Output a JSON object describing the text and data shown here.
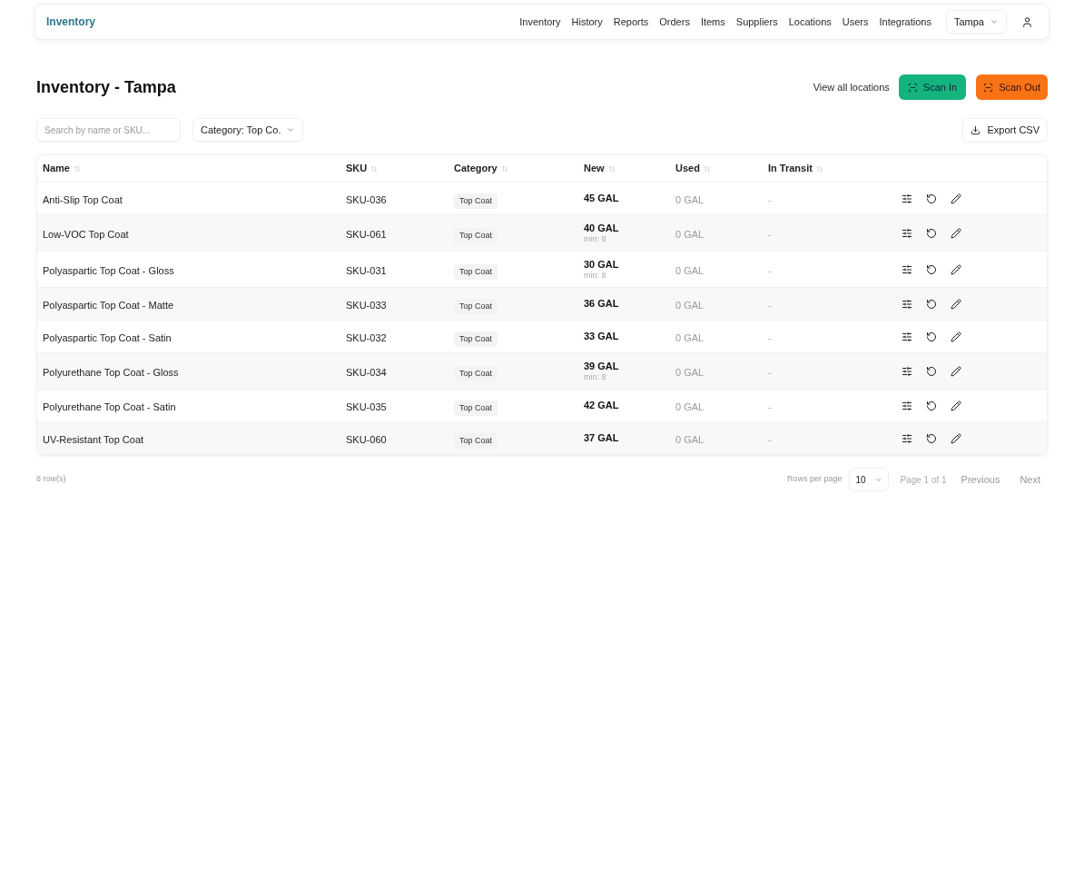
{
  "header": {
    "logo": "Inventory",
    "nav": [
      "Inventory",
      "History",
      "Reports",
      "Orders",
      "Items",
      "Suppliers",
      "Locations",
      "Users",
      "Integrations"
    ],
    "location_select": "Tampa"
  },
  "page": {
    "title": "Inventory - Tampa",
    "view_all_link": "View all locations",
    "scan_in": "Scan In",
    "scan_out": "Scan Out"
  },
  "toolbar": {
    "search": {
      "placeholder": "Search by name or SKU..."
    },
    "category_filter": "Category: Top Co.",
    "export": "Export CSV"
  },
  "table": {
    "columns": [
      "Name",
      "SKU",
      "Category",
      "New",
      "Used",
      "In Transit"
    ],
    "rows": [
      {
        "name": "Anti-Slip Top Coat",
        "sku": "SKU-036",
        "category": "Top Coat",
        "new": "45 GAL",
        "used": "0 GAL",
        "in_transit": "-"
      },
      {
        "name": "Low-VOC Top Coat",
        "sku": "SKU-061",
        "category": "Top Coat",
        "new": "40 GAL",
        "min": "min: 8",
        "used": "0 GAL",
        "in_transit": "-"
      },
      {
        "name": "Polyaspartic Top Coat - Gloss",
        "sku": "SKU-031",
        "category": "Top Coat",
        "new": "30 GAL",
        "min": "min: 8",
        "used": "0 GAL",
        "in_transit": "-"
      },
      {
        "name": "Polyaspartic Top Coat - Matte",
        "sku": "SKU-033",
        "category": "Top Coat",
        "new": "36 GAL",
        "used": "0 GAL",
        "in_transit": "-"
      },
      {
        "name": "Polyaspartic Top Coat - Satin",
        "sku": "SKU-032",
        "category": "Top Coat",
        "new": "33 GAL",
        "used": "0 GAL",
        "in_transit": "-"
      },
      {
        "name": "Polyurethane Top Coat - Gloss",
        "sku": "SKU-034",
        "category": "Top Coat",
        "new": "39 GAL",
        "min": "min: 8",
        "used": "0 GAL",
        "in_transit": "-"
      },
      {
        "name": "Polyurethane Top Coat - Satin",
        "sku": "SKU-035",
        "category": "Top Coat",
        "new": "42 GAL",
        "used": "0 GAL",
        "in_transit": "-"
      },
      {
        "name": "UV-Resistant Top Coat",
        "sku": "SKU-060",
        "category": "Top Coat",
        "new": "37 GAL",
        "used": "0 GAL",
        "in_transit": "-"
      }
    ]
  },
  "footer": {
    "row_count": "8 row(s)",
    "rows_per_page_label": "Rows per page",
    "rows_per_page": "10",
    "page_info": "Page 1 of 1",
    "previous": {
      "label": "Previous",
      "disabled": true
    },
    "next": {
      "label": "Next",
      "disabled": true
    }
  }
}
